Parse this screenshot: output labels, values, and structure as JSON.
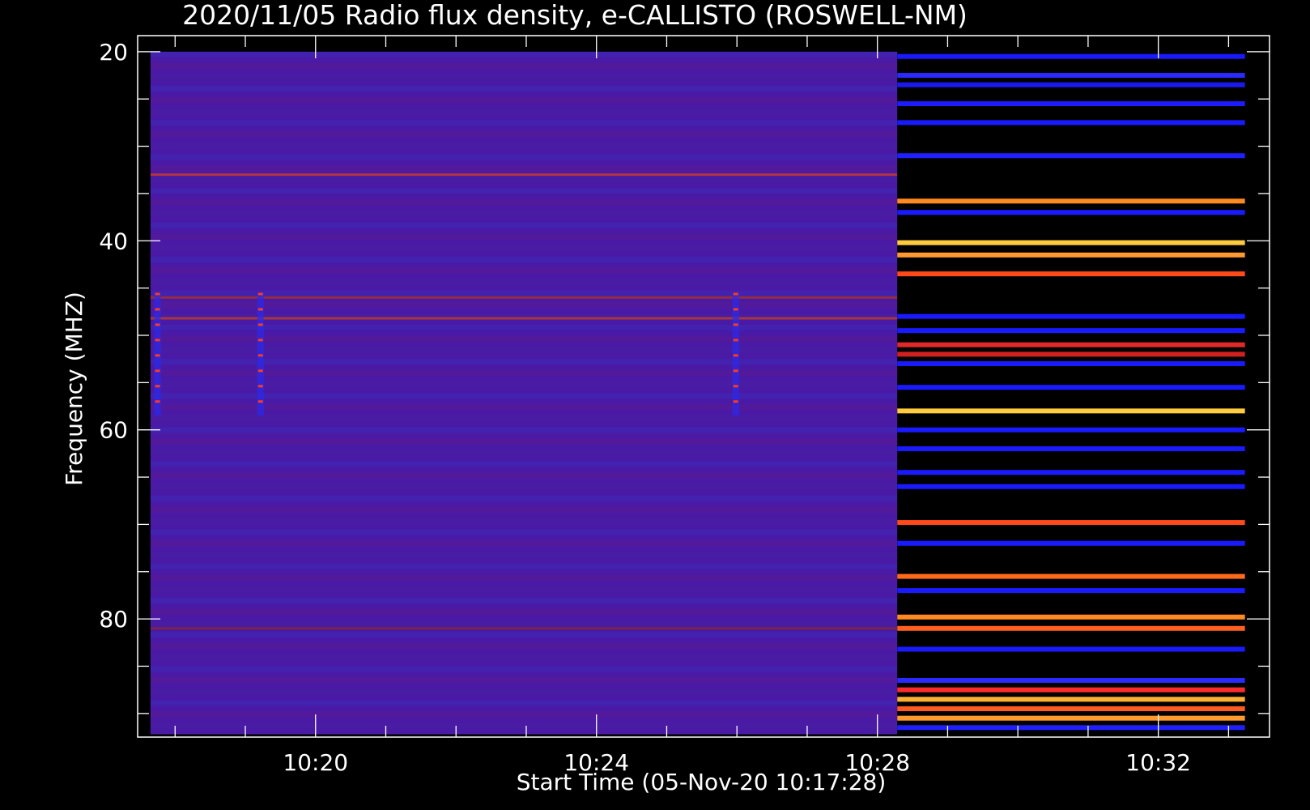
{
  "chart_data": {
    "type": "heatmap",
    "title": "2020/11/05  Radio flux density, e-CALLISTO (ROSWELL-NM)",
    "xlabel": "Start Time (05-Nov-20 10:17:28)",
    "ylabel": "Frequency (MHZ)",
    "xlim": [
      "10:17:28",
      "10:33:35"
    ],
    "ylim": [
      92.5,
      18.3
    ],
    "x_ticks": [
      "10:20",
      "10:24",
      "10:28",
      "10:32"
    ],
    "y_ticks": [
      20,
      40,
      60,
      80
    ],
    "data_extent": {
      "time_start": "10:17:39",
      "time_end": "10:33:14",
      "freq_top": 20,
      "freq_bottom": 92.2
    },
    "segments": [
      {
        "time_start": "10:17:39",
        "time_end": "10:28:17",
        "background": "#4a1aa6",
        "bands_mhz": [
          {
            "freq": 33,
            "color": "#d43c1c"
          },
          {
            "freq": 48.2,
            "color": "#c4401c"
          },
          {
            "freq": 46,
            "color": "#b03418"
          },
          {
            "freq": 81,
            "color": "#8a2a2a"
          }
        ],
        "vertical_bursts": [
          {
            "time": "10:17:45",
            "freq_from": 45.5,
            "freq_to": 58.5
          },
          {
            "time": "10:19:13",
            "freq_from": 45.5,
            "freq_to": 58.5
          },
          {
            "time": "10:25:59",
            "freq_from": 45.5,
            "freq_to": 58.5
          }
        ]
      },
      {
        "time_start": "10:28:17",
        "time_end": "10:33:14",
        "background": "#000000",
        "bands_mhz": [
          {
            "freq": 20.5,
            "color": "#1a1aff"
          },
          {
            "freq": 22.5,
            "color": "#2a2aff"
          },
          {
            "freq": 23.5,
            "color": "#1a1aee"
          },
          {
            "freq": 25.5,
            "color": "#1c1cff"
          },
          {
            "freq": 27.5,
            "color": "#1a1aff"
          },
          {
            "freq": 31,
            "color": "#2020ff"
          },
          {
            "freq": 35.8,
            "color": "#ff8a20"
          },
          {
            "freq": 37,
            "color": "#1a1aff"
          },
          {
            "freq": 40.2,
            "color": "#ffcc40"
          },
          {
            "freq": 41.5,
            "color": "#ff9a30"
          },
          {
            "freq": 43.5,
            "color": "#ff4a1a"
          },
          {
            "freq": 48,
            "color": "#1a1aff"
          },
          {
            "freq": 49.5,
            "color": "#1a1aff"
          },
          {
            "freq": 51,
            "color": "#e02a2a"
          },
          {
            "freq": 52,
            "color": "#d02020"
          },
          {
            "freq": 53,
            "color": "#1a1aff"
          },
          {
            "freq": 55.5,
            "color": "#1a1aff"
          },
          {
            "freq": 58,
            "color": "#ffcc40"
          },
          {
            "freq": 60,
            "color": "#1a1aff"
          },
          {
            "freq": 62,
            "color": "#1a1aff"
          },
          {
            "freq": 64.5,
            "color": "#1a1aff"
          },
          {
            "freq": 66,
            "color": "#1a1aff"
          },
          {
            "freq": 69.8,
            "color": "#ff4a1a"
          },
          {
            "freq": 72,
            "color": "#1a1aff"
          },
          {
            "freq": 75.5,
            "color": "#ff6a1a"
          },
          {
            "freq": 77,
            "color": "#1a1aff"
          },
          {
            "freq": 79.8,
            "color": "#ff8a20"
          },
          {
            "freq": 81,
            "color": "#ff6020"
          },
          {
            "freq": 83.2,
            "color": "#1a1aff"
          },
          {
            "freq": 86.5,
            "color": "#2a2aff"
          },
          {
            "freq": 87.5,
            "color": "#ff2a2a"
          },
          {
            "freq": 88.5,
            "color": "#ffb030"
          },
          {
            "freq": 89.5,
            "color": "#ff5a20"
          },
          {
            "freq": 90.5,
            "color": "#ff9a30"
          },
          {
            "freq": 91.5,
            "color": "#2020ff"
          }
        ]
      }
    ]
  }
}
